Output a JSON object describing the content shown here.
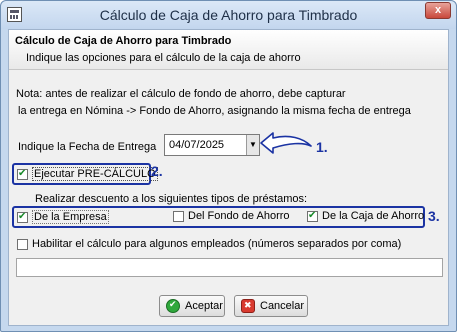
{
  "window": {
    "title": "Cálculo de Caja de Ahorro para Timbrado",
    "close_label": "x",
    "icon": "calculator-icon"
  },
  "header": {
    "title": "Cálculo de Caja de Ahorro para Timbrado",
    "subtitle": "Indique las opciones para el cálculo de la caja de ahorro"
  },
  "note": {
    "line1": "Nota: antes de realizar el cálculo de fondo de ahorro, debe capturar",
    "line2": "la entrega en Nómina -> Fondo de Ahorro, asignando la misma fecha de entrega"
  },
  "fecha": {
    "label": "Indique la Fecha de Entrega",
    "value": "04/07/2025"
  },
  "precalculo": {
    "label": "Ejecutar PRE-CÁLCULO",
    "checked": true
  },
  "descuento": {
    "label": "Realizar descuento a los siguientes tipos de préstamos:",
    "options": [
      {
        "label": "De la Empresa",
        "checked": true
      },
      {
        "label": "Del Fondo de Ahorro",
        "checked": false
      },
      {
        "label": "De la Caja de Ahorro",
        "checked": true
      }
    ]
  },
  "habilitar": {
    "label": "Habilitar el cálculo para algunos empleados (números separados por coma)",
    "checked": false,
    "value": ""
  },
  "buttons": {
    "accept": "Aceptar",
    "cancel": "Cancelar"
  },
  "annotations": {
    "n1": "1.",
    "n2": "2.",
    "n3": "3."
  },
  "colors": {
    "annotation": "#1b33a3",
    "accept_icon": "#2fa83c",
    "cancel_icon": "#d93a2f"
  }
}
